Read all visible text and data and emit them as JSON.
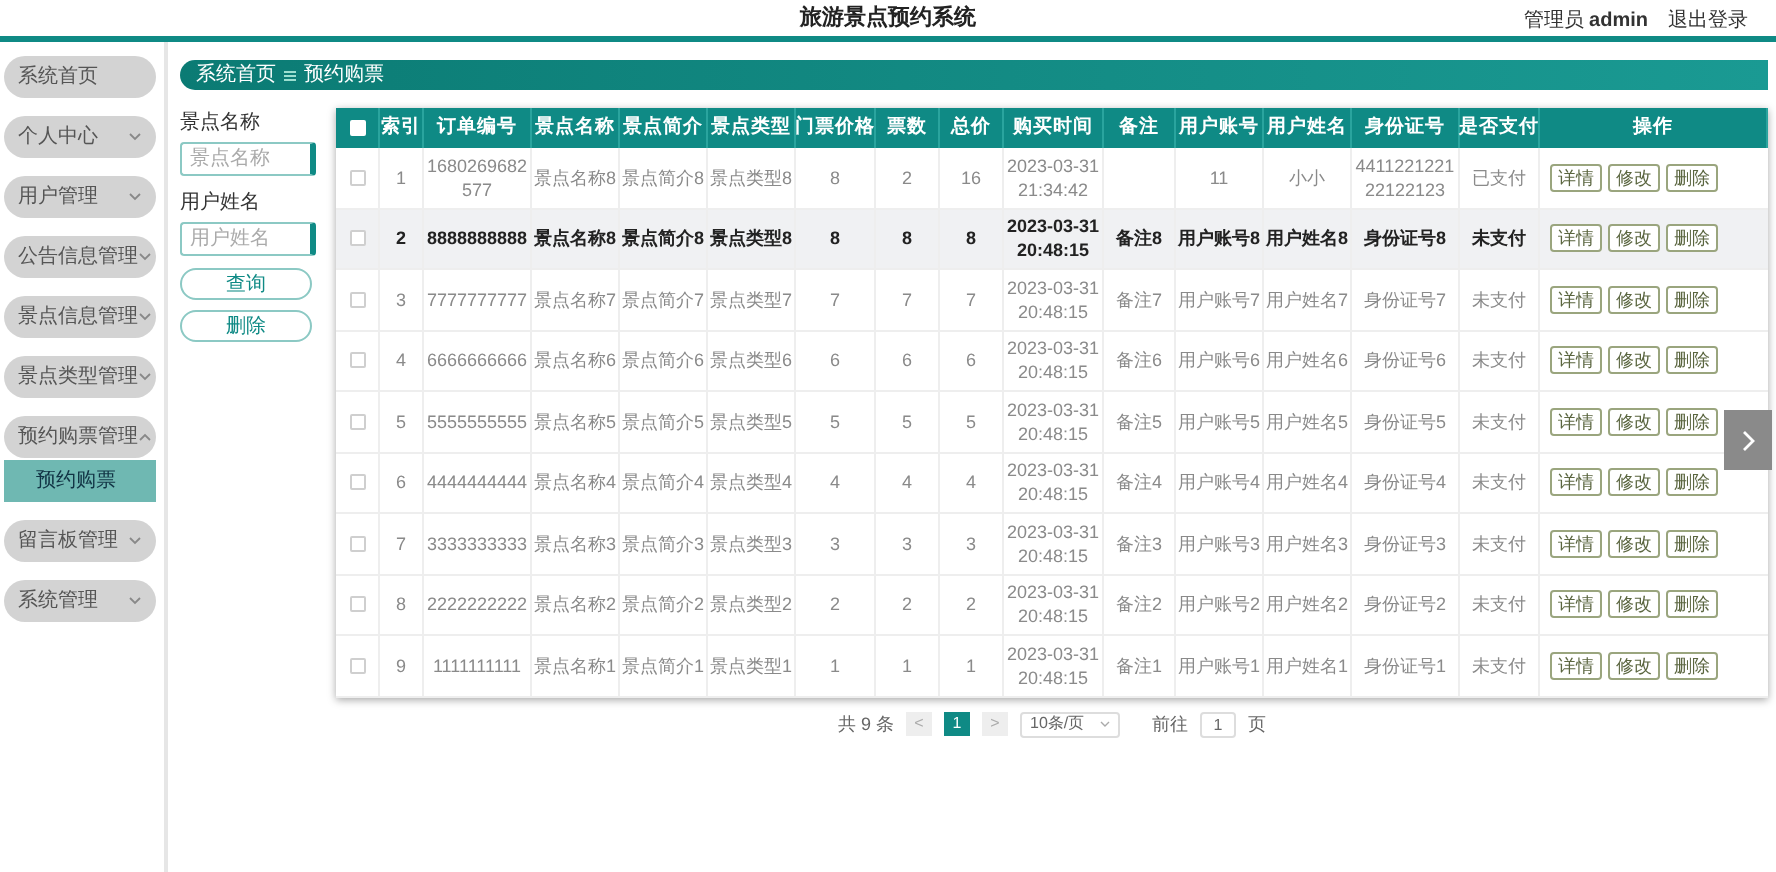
{
  "header": {
    "title": "旅游景点预约系统",
    "user": "管理员 **admin**",
    "logout": "退出登录"
  },
  "sidebar": {
    "items": [
      {
        "label": "系统首页",
        "kind": "link"
      },
      {
        "label": "个人中心",
        "kind": "menu",
        "expanded": false
      },
      {
        "label": "用户管理",
        "kind": "menu",
        "expanded": false
      },
      {
        "label": "公告信息管理",
        "kind": "menu",
        "expanded": false
      },
      {
        "label": "景点信息管理",
        "kind": "menu",
        "expanded": false
      },
      {
        "label": "景点类型管理",
        "kind": "menu",
        "expanded": false
      },
      {
        "label": "预约购票管理",
        "kind": "menu",
        "expanded": true,
        "children": [
          {
            "label": "预约购票",
            "selected": true
          }
        ]
      },
      {
        "label": "留言板管理",
        "kind": "menu",
        "expanded": false
      },
      {
        "label": "系统管理",
        "kind": "menu",
        "expanded": false
      }
    ]
  },
  "breadcrumb": [
    "系统首页",
    "预约购票"
  ],
  "search": {
    "fields": [
      {
        "label": "景点名称",
        "placeholder": "景点名称"
      },
      {
        "label": "用户姓名",
        "placeholder": "用户姓名"
      }
    ],
    "buttons": [
      "查询",
      "删除"
    ]
  },
  "table": {
    "header_checked": false,
    "columns": [
      "索引",
      "订单编号",
      "景点名称",
      "景点简介",
      "景点类型",
      "门票价格",
      "票数",
      "总价",
      "购买时间",
      "备注",
      "用户账号",
      "用户姓名",
      "身份证号",
      "是否支付",
      "操作"
    ],
    "rows": [
      {
        "checked": false,
        "highlighted": false,
        "cells": [
          "1",
          "1680269682577",
          "景点名称8",
          "景点简介8",
          "景点类型8",
          "8",
          "2",
          "16",
          "2023-03-31 21:34:42",
          "",
          "11",
          "小小",
          "441122122122122123",
          "已支付"
        ],
        "actions": [
          "详情",
          "修改",
          "删除"
        ]
      },
      {
        "checked": false,
        "highlighted": true,
        "cells": [
          "2",
          "8888888888",
          "景点名称8",
          "景点简介8",
          "景点类型8",
          "8",
          "8",
          "8",
          "2023-03-31 20:48:15",
          "备注8",
          "用户账号8",
          "用户姓名8",
          "身份证号8",
          "未支付"
        ],
        "actions": [
          "详情",
          "修改",
          "删除"
        ]
      },
      {
        "checked": false,
        "highlighted": false,
        "cells": [
          "3",
          "7777777777",
          "景点名称7",
          "景点简介7",
          "景点类型7",
          "7",
          "7",
          "7",
          "2023-03-31 20:48:15",
          "备注7",
          "用户账号7",
          "用户姓名7",
          "身份证号7",
          "未支付"
        ],
        "actions": [
          "详情",
          "修改",
          "删除"
        ]
      },
      {
        "checked": false,
        "highlighted": false,
        "cells": [
          "4",
          "6666666666",
          "景点名称6",
          "景点简介6",
          "景点类型6",
          "6",
          "6",
          "6",
          "2023-03-31 20:48:15",
          "备注6",
          "用户账号6",
          "用户姓名6",
          "身份证号6",
          "未支付"
        ],
        "actions": [
          "详情",
          "修改",
          "删除"
        ]
      },
      {
        "checked": false,
        "highlighted": false,
        "cells": [
          "5",
          "5555555555",
          "景点名称5",
          "景点简介5",
          "景点类型5",
          "5",
          "5",
          "5",
          "2023-03-31 20:48:15",
          "备注5",
          "用户账号5",
          "用户姓名5",
          "身份证号5",
          "未支付"
        ],
        "actions": [
          "详情",
          "修改",
          "删除"
        ]
      },
      {
        "checked": false,
        "highlighted": false,
        "cells": [
          "6",
          "4444444444",
          "景点名称4",
          "景点简介4",
          "景点类型4",
          "4",
          "4",
          "4",
          "2023-03-31 20:48:15",
          "备注4",
          "用户账号4",
          "用户姓名4",
          "身份证号4",
          "未支付"
        ],
        "actions": [
          "详情",
          "修改",
          "删除"
        ]
      },
      {
        "checked": false,
        "highlighted": false,
        "cells": [
          "7",
          "3333333333",
          "景点名称3",
          "景点简介3",
          "景点类型3",
          "3",
          "3",
          "3",
          "2023-03-31 20:48:15",
          "备注3",
          "用户账号3",
          "用户姓名3",
          "身份证号3",
          "未支付"
        ],
        "actions": [
          "详情",
          "修改",
          "删除"
        ]
      },
      {
        "checked": false,
        "highlighted": false,
        "cells": [
          "8",
          "2222222222",
          "景点名称2",
          "景点简介2",
          "景点类型2",
          "2",
          "2",
          "2",
          "2023-03-31 20:48:15",
          "备注2",
          "用户账号2",
          "用户姓名2",
          "身份证号2",
          "未支付"
        ],
        "actions": [
          "详情",
          "修改",
          "删除"
        ]
      },
      {
        "checked": false,
        "highlighted": false,
        "cells": [
          "9",
          "1111111111",
          "景点名称1",
          "景点简介1",
          "景点类型1",
          "1",
          "1",
          "1",
          "2023-03-31 20:48:15",
          "备注1",
          "用户账号1",
          "用户姓名1",
          "身份证号1",
          "未支付"
        ],
        "actions": [
          "详情",
          "修改",
          "删除"
        ]
      }
    ]
  },
  "pagination": {
    "total": "共 9 条",
    "prev": "<",
    "pages": [
      {
        "label": "1",
        "selected": true
      }
    ],
    "next": ">",
    "page_size": "10条/页",
    "goto_label": "前往",
    "goto_value": "1",
    "goto_unit": "页"
  }
}
